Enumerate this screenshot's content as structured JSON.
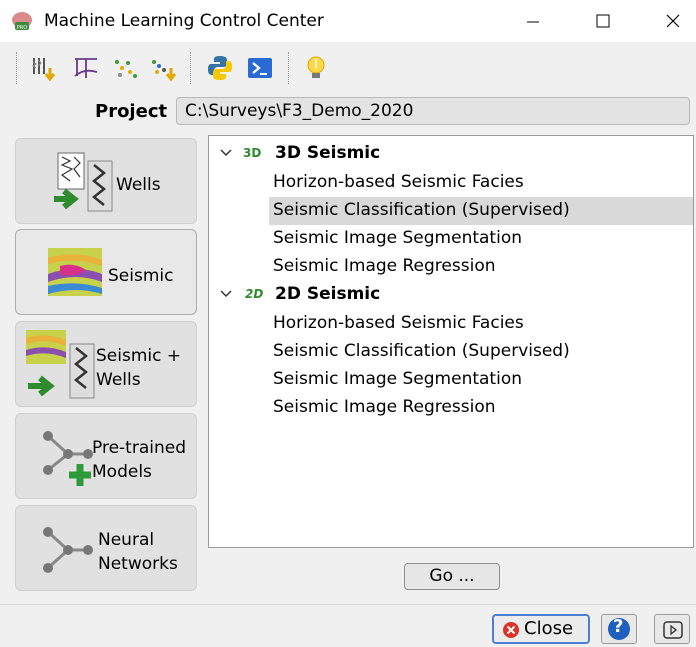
{
  "window": {
    "title": "Machine Learning Control Center"
  },
  "project": {
    "label": "Project",
    "path": "C:\\Surveys\\F3_Demo_2020"
  },
  "sidebar": {
    "wells": "Wells",
    "seismic": "Seismic",
    "seismic_wells_1": "Seismic +",
    "seismic_wells_2": "Wells",
    "pretrained_1": "Pre-trained",
    "pretrained_2": "Models",
    "neural_1": "Neural",
    "neural_2": "Networks"
  },
  "tree": {
    "group3d": {
      "badge": "3D",
      "label": "3D Seismic",
      "items": [
        "Horizon-based Seismic Facies",
        "Seismic Classification (Supervised)",
        "Seismic Image Segmentation",
        "Seismic Image Regression"
      ]
    },
    "group2d": {
      "badge": "2D",
      "label": "2D Seismic",
      "items": [
        "Horizon-based Seismic Facies",
        "Seismic Classification (Supervised)",
        "Seismic Image Segmentation",
        "Seismic Image Regression"
      ]
    }
  },
  "buttons": {
    "go": "Go ...",
    "close": "Close",
    "help": "?"
  }
}
